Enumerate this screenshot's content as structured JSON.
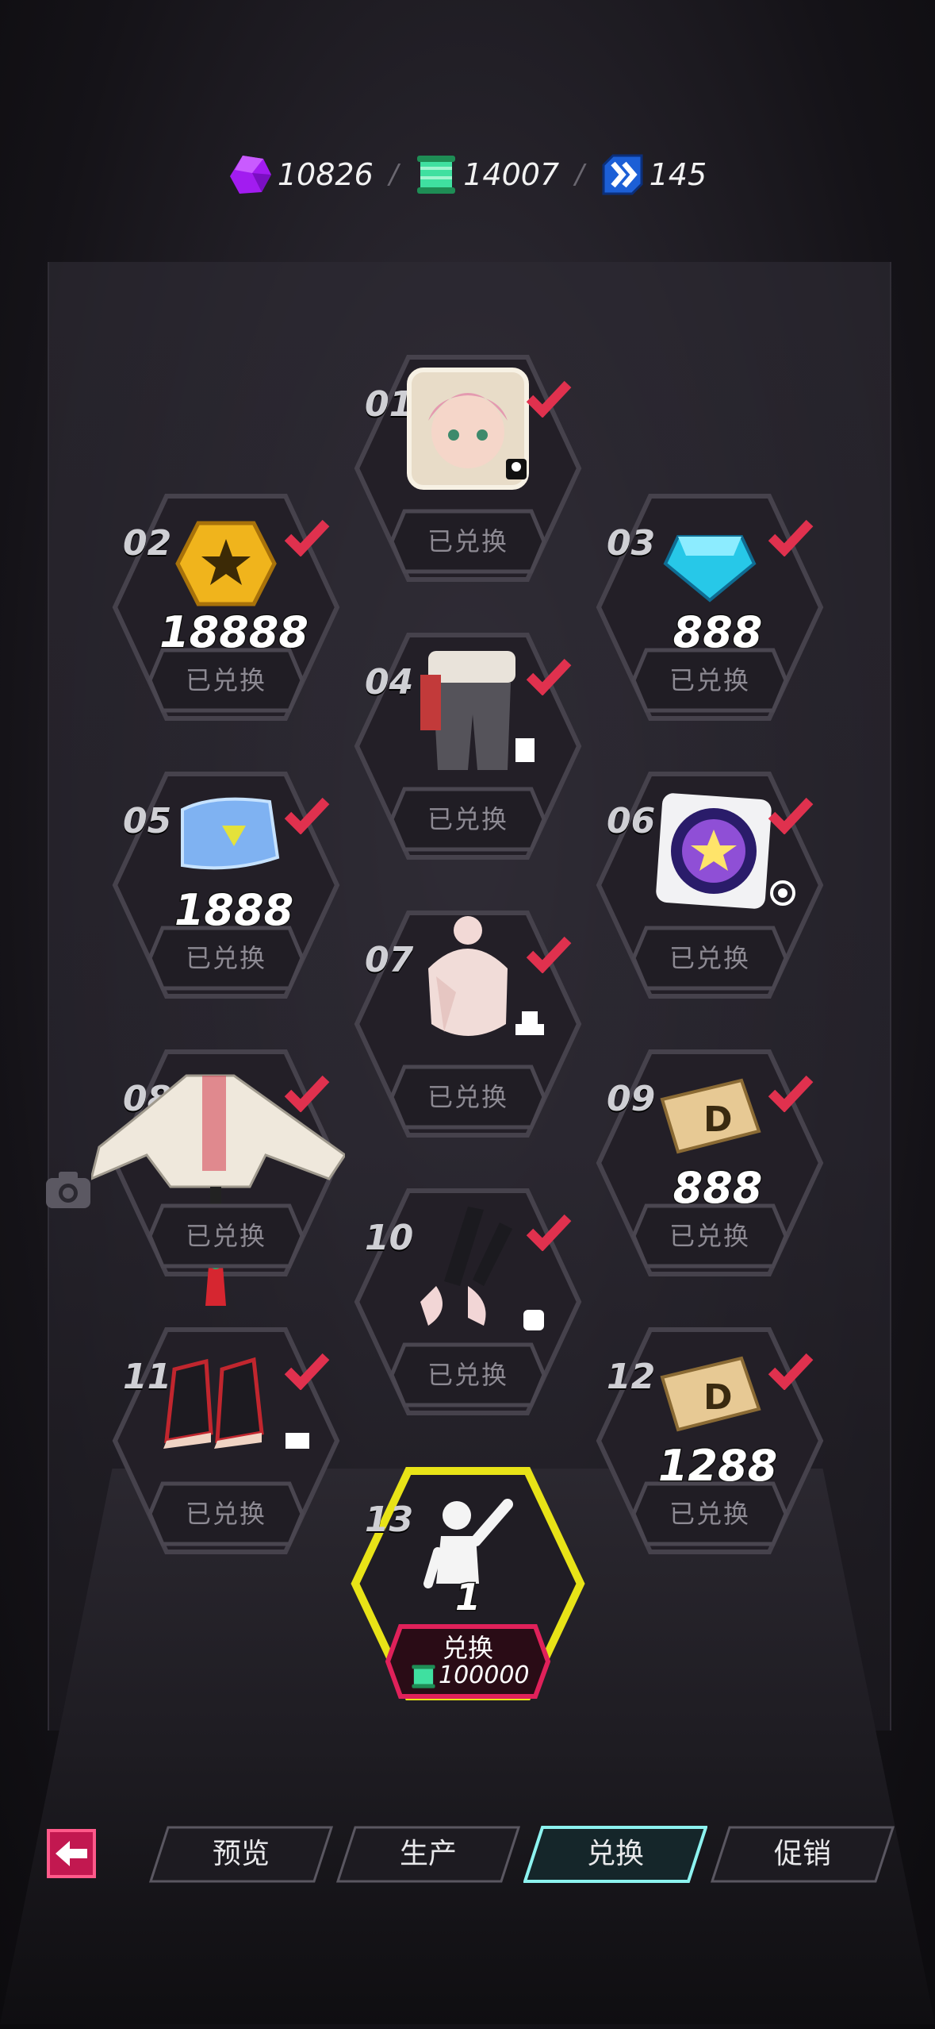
{
  "currencies": [
    {
      "icon": "purple-crystal-icon",
      "value": "10826"
    },
    {
      "icon": "green-scroll-icon",
      "value": "14007"
    },
    {
      "icon": "blue-chevron-badge-icon",
      "value": "145"
    }
  ],
  "items": [
    {
      "num": "01",
      "kind": "portrait",
      "status": "已兑换"
    },
    {
      "num": "02",
      "kind": "gold-coin",
      "qty": "18888",
      "status": "已兑换"
    },
    {
      "num": "03",
      "kind": "blue-gem",
      "qty": "888",
      "status": "已兑换"
    },
    {
      "num": "04",
      "kind": "pants",
      "status": "已兑换"
    },
    {
      "num": "05",
      "kind": "ticket",
      "qty": "1888",
      "status": "已兑换"
    },
    {
      "num": "06",
      "kind": "star-orb",
      "status": "已兑换"
    },
    {
      "num": "07",
      "kind": "hair",
      "status": "已兑换"
    },
    {
      "num": "08",
      "kind": "jacket",
      "status": "已兑换"
    },
    {
      "num": "09",
      "kind": "d-ticket",
      "qty": "888",
      "status": "已兑换"
    },
    {
      "num": "10",
      "kind": "gloves",
      "status": "已兑换"
    },
    {
      "num": "11",
      "kind": "shoes",
      "status": "已兑换"
    },
    {
      "num": "12",
      "kind": "d-ticket",
      "qty": "1288",
      "status": "已兑换"
    },
    {
      "num": "13",
      "kind": "emote",
      "qty": "1"
    }
  ],
  "current_item": {
    "button_label": "兑换",
    "cost": "100000",
    "cost_icon": "green-scroll-icon"
  },
  "tabs": [
    {
      "label": "预览",
      "active": false
    },
    {
      "label": "生产",
      "active": false
    },
    {
      "label": "兑换",
      "active": true
    },
    {
      "label": "促销",
      "active": false
    }
  ],
  "colors": {
    "check": "#e0314e",
    "highlight": "#e8e317",
    "accent_pink": "#e0215a",
    "tab_active": "#8df3f0"
  }
}
